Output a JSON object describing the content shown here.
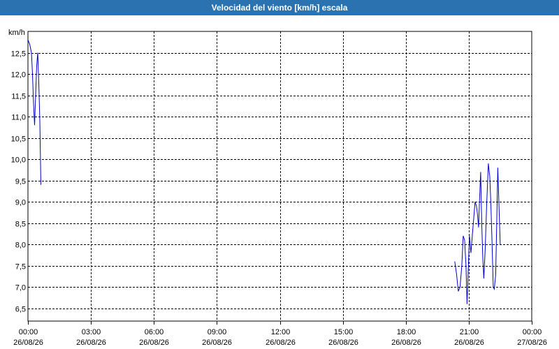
{
  "window": {
    "title": "Velocidad del viento [km/h] escala"
  },
  "chart_data": {
    "type": "line",
    "title": "Velocidad del viento [km/h] escala",
    "ylabel": "km/h",
    "ylim": [
      6.2,
      13.0
    ],
    "y_ticks": [
      "6,5",
      "7,0",
      "7,5",
      "8,0",
      "8,5",
      "9,0",
      "9,5",
      "10,0",
      "10,5",
      "11,0",
      "11,5",
      "12,0",
      "12,5"
    ],
    "y_tick_values": [
      6.5,
      7.0,
      7.5,
      8.0,
      8.5,
      9.0,
      9.5,
      10.0,
      10.5,
      11.0,
      11.5,
      12.0,
      12.5
    ],
    "x_ticks": [
      {
        "time": "00:00",
        "date": "26/08/26"
      },
      {
        "time": "03:00",
        "date": "26/08/26"
      },
      {
        "time": "06:00",
        "date": "26/08/26"
      },
      {
        "time": "09:00",
        "date": "26/08/26"
      },
      {
        "time": "12:00",
        "date": "26/08/26"
      },
      {
        "time": "15:00",
        "date": "26/08/26"
      },
      {
        "time": "18:00",
        "date": "26/08/26"
      },
      {
        "time": "21:00",
        "date": "26/08/26"
      },
      {
        "time": "00:00",
        "date": "27/08/26"
      }
    ],
    "grid": true,
    "line_color": "#0000cc",
    "series": [
      {
        "name": "",
        "segments": [
          [
            [
              "26/08/26 00:00",
              12.8
            ],
            [
              "26/08/26 00:05",
              12.7
            ],
            [
              "26/08/26 00:10",
              12.5
            ],
            [
              "26/08/26 00:13",
              12.0
            ],
            [
              "26/08/26 00:16",
              11.3
            ],
            [
              "26/08/26 00:19",
              10.8
            ],
            [
              "26/08/26 00:22",
              11.5
            ],
            [
              "26/08/26 00:25",
              12.2
            ],
            [
              "26/08/26 00:28",
              12.5
            ],
            [
              "26/08/26 00:31",
              11.8
            ],
            [
              "26/08/26 00:34",
              10.9
            ],
            [
              "26/08/26 00:37",
              9.4
            ]
          ],
          [
            [
              "26/08/26 20:20",
              7.6
            ],
            [
              "26/08/26 20:25",
              7.3
            ],
            [
              "26/08/26 20:30",
              6.9
            ],
            [
              "26/08/26 20:35",
              7.0
            ],
            [
              "26/08/26 20:40",
              7.5
            ],
            [
              "26/08/26 20:44",
              8.2
            ],
            [
              "26/08/26 20:48",
              8.1
            ],
            [
              "26/08/26 20:52",
              7.5
            ],
            [
              "26/08/26 20:55",
              6.6
            ],
            [
              "26/08/26 20:58",
              7.3
            ],
            [
              "26/08/26 21:02",
              8.2
            ],
            [
              "26/08/26 21:06",
              7.8
            ],
            [
              "26/08/26 21:10",
              8.2
            ],
            [
              "26/08/26 21:14",
              8.6
            ],
            [
              "26/08/26 21:18",
              9.0
            ],
            [
              "26/08/26 21:22",
              8.9
            ],
            [
              "26/08/26 21:25",
              8.7
            ],
            [
              "26/08/26 21:28",
              8.4
            ],
            [
              "26/08/26 21:31",
              9.1
            ],
            [
              "26/08/26 21:34",
              9.7
            ],
            [
              "26/08/26 21:37",
              8.5
            ],
            [
              "26/08/26 21:40",
              7.7
            ],
            [
              "26/08/26 21:43",
              7.2
            ],
            [
              "26/08/26 21:47",
              7.9
            ],
            [
              "26/08/26 21:51",
              8.9
            ],
            [
              "26/08/26 21:56",
              9.9
            ],
            [
              "26/08/26 22:00",
              9.6
            ],
            [
              "26/08/26 22:03",
              9.0
            ],
            [
              "26/08/26 22:06",
              8.2
            ],
            [
              "26/08/26 22:10",
              7.0
            ],
            [
              "26/08/26 22:13",
              6.95
            ],
            [
              "26/08/26 22:17",
              7.3
            ],
            [
              "26/08/26 22:20",
              8.5
            ],
            [
              "26/08/26 22:23",
              9.8
            ],
            [
              "26/08/26 22:26",
              9.0
            ],
            [
              "26/08/26 22:30",
              8.0
            ]
          ]
        ]
      }
    ]
  }
}
